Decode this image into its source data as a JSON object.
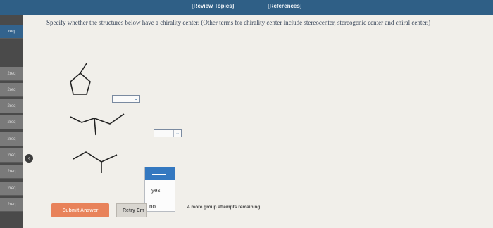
{
  "header": {
    "review_topics": "[Review Topics]",
    "references": "[References]"
  },
  "sidebar": {
    "items": [
      {
        "label": "req"
      },
      {
        "label": "2req"
      },
      {
        "label": "2req"
      },
      {
        "label": "2req"
      },
      {
        "label": "2req"
      },
      {
        "label": "2req"
      },
      {
        "label": "2req"
      },
      {
        "label": "2req"
      },
      {
        "label": "2req"
      },
      {
        "label": "2req"
      }
    ],
    "collapse_icon": "chevron-left-icon"
  },
  "question": {
    "instructions": "Specify whether the structures below have a chirality center. (Other terms for chirality center include stereocenter, stereogenic center and chiral center.)"
  },
  "dropdowns": {
    "first_value": "",
    "second_value": "",
    "options": [
      "",
      "yes",
      "no"
    ]
  },
  "actions": {
    "submit_label": "Submit Answer",
    "retry_label": "Retry Em",
    "attempts_text": "4 more group attempts remaining"
  },
  "colors": {
    "topbar": "#2f5f86",
    "submit": "#e8825a",
    "menu_highlight": "#3478c0"
  }
}
